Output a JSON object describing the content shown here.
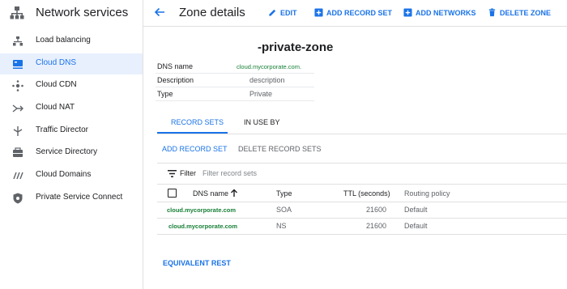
{
  "sidebar": {
    "title": "Network services",
    "items": [
      {
        "label": "Load balancing",
        "icon": "load-balancing-icon"
      },
      {
        "label": "Cloud DNS",
        "icon": "cloud-dns-icon",
        "active": true
      },
      {
        "label": "Cloud CDN",
        "icon": "cloud-cdn-icon"
      },
      {
        "label": "Cloud NAT",
        "icon": "cloud-nat-icon"
      },
      {
        "label": "Traffic Director",
        "icon": "traffic-director-icon"
      },
      {
        "label": "Service Directory",
        "icon": "service-directory-icon"
      },
      {
        "label": "Cloud Domains",
        "icon": "cloud-domains-icon"
      },
      {
        "label": "Private Service Connect",
        "icon": "private-service-connect-icon"
      }
    ]
  },
  "header": {
    "title": "Zone details",
    "edit": "EDIT",
    "add_record_set": "ADD RECORD SET",
    "add_networks": "ADD NETWORKS",
    "delete_zone": "DELETE ZONE"
  },
  "zone": {
    "name": "-private-zone",
    "details": [
      {
        "key": "DNS name",
        "value": "cloud.mycorporate.com."
      },
      {
        "key": "Description",
        "value": "description"
      },
      {
        "key": "Type",
        "value": "Private"
      }
    ]
  },
  "tabs": [
    "RECORD SETS",
    "IN USE BY"
  ],
  "actions": {
    "add_record_set": "ADD RECORD SET",
    "delete_record_sets": "DELETE RECORD SETS"
  },
  "filter": {
    "label": "Filter",
    "placeholder": "Filter record sets"
  },
  "table": {
    "columns": [
      "DNS name",
      "Type",
      "TTL (seconds)",
      "Routing policy"
    ],
    "rows": [
      {
        "dns_name": "cloud.mycorporate.com",
        "type": "SOA",
        "ttl": "21600",
        "routing": "Default"
      },
      {
        "dns_name": "cloud.mycorporate.com",
        "type": "NS",
        "ttl": "21600",
        "routing": "Default"
      }
    ]
  },
  "footer": {
    "equivalent_rest": "EQUIVALENT REST"
  },
  "colors": {
    "accent": "#1a73e8",
    "active_bg": "#e8f0fe",
    "dns_green": "#188038"
  }
}
